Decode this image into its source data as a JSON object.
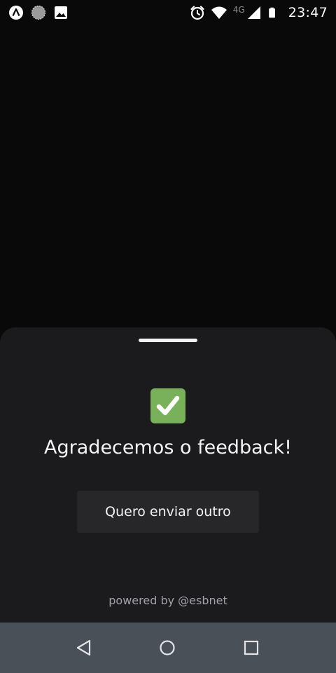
{
  "status_bar": {
    "network_type": "4G",
    "time": "23:47",
    "left_icons": [
      "launcher-app-icon",
      "sync-icon",
      "image-icon"
    ],
    "right_icons": [
      "alarm-icon",
      "wifi-icon",
      "cellular-signal-icon",
      "battery-icon"
    ]
  },
  "sheet": {
    "status_icon": "check-mark-icon",
    "title": "Agradecemos o feedback!",
    "button_label": "Quero enviar outro",
    "footer_prefix": "powered by ",
    "footer_handle": "@esbnet"
  },
  "nav_bar": {
    "buttons": [
      "back",
      "home",
      "recents"
    ]
  },
  "colors": {
    "background": "#09090a",
    "sheet": "#1b1b1d",
    "button": "#27272a",
    "text": "#f4f4f5",
    "muted": "#a1a1aa",
    "check_green": "#78b159",
    "nav_bar": "#4a5058"
  }
}
